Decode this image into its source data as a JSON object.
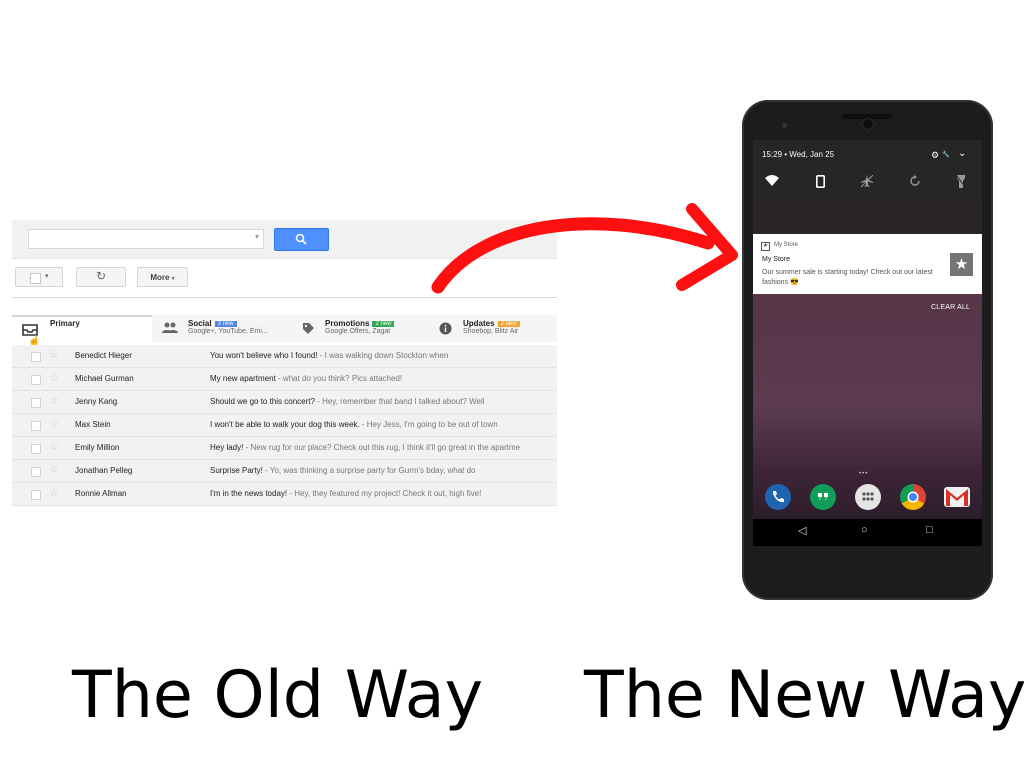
{
  "old_way": {
    "caption": "The Old Way",
    "toolbar": {
      "more_label": "More",
      "more_caret": "▾",
      "select_caret": "▾",
      "refresh_glyph": "↻",
      "search_caret": "▾"
    },
    "tabs": [
      {
        "name": "Primary",
        "sub": "",
        "badge": "",
        "icon": "inbox-icon"
      },
      {
        "name": "Social",
        "sub": "Google+, YouTube, Emi...",
        "badge": "3 new",
        "badge_color": "#4f85e8",
        "icon": "people-icon"
      },
      {
        "name": "Promotions",
        "sub": "Google Offers, Zagat",
        "badge": "2 new",
        "badge_color": "#35a853",
        "icon": "tag-icon"
      },
      {
        "name": "Updates",
        "sub": "Shoebop, Blitz Air",
        "badge": "2 new",
        "badge_color": "#f3a433",
        "icon": "info-icon"
      }
    ],
    "emails": [
      {
        "sender": "Benedict Hieger",
        "subject": "You won't believe who I found!",
        "snippet": " - I was walking down Stockton when"
      },
      {
        "sender": "Michael Gurman",
        "subject": "My new apartment",
        "snippet": " - what do you think? Pics attached!"
      },
      {
        "sender": "Jenny Kang",
        "subject": "Should we go to this concert?",
        "snippet": " - Hey, remember that band I talked about? Well"
      },
      {
        "sender": "Max Stein",
        "subject": "I won't be able to walk your dog this week.",
        "snippet": " - Hey Jess, I'm going to be out of town"
      },
      {
        "sender": "Emily Million",
        "subject": "Hey lady!",
        "snippet": " - New rug for our place? Check out this rug, I think it'll go great in the apartme"
      },
      {
        "sender": "Jonathan Pelleg",
        "subject": "Surprise Party!",
        "snippet": " - Yo, was thinking a surprise party for Gurm's bday, what do"
      },
      {
        "sender": "Ronnie Allman",
        "subject": "I'm in the news today!",
        "snippet": " - Hey, they featured my project! Check it out, high five!"
      }
    ]
  },
  "new_way": {
    "caption": "The New Way",
    "status": {
      "time_date": "15:29 • Wed, Jan 25",
      "gear_glyph": "⚙",
      "wrench_glyph": "🔧",
      "chevron_glyph": "⌄"
    },
    "quick_settings": [
      "wifi-icon",
      "phone-icon",
      "airplane-icon",
      "rotate-icon",
      "flashlight-icon"
    ],
    "notification": {
      "app_icon_glyph": "★",
      "app_name": "My Store",
      "title": "My Store",
      "body": "Our summer sale is starting today! Check out our latest fashions 😎",
      "image_glyph": "★"
    },
    "clear_all": "CLEAR ALL",
    "pager_dots": "•••",
    "dock": [
      {
        "name": "phone-app-icon",
        "color": "#1e64b0"
      },
      {
        "name": "hangouts-app-icon",
        "color": "#0f9d58"
      },
      {
        "name": "app-drawer-icon",
        "color": "#e5e5e5"
      },
      {
        "name": "chrome-app-icon",
        "color": "#db4437"
      },
      {
        "name": "gmail-app-icon",
        "color": "#d93025"
      }
    ],
    "nav": {
      "back": "◁",
      "home": "○",
      "recents": "□"
    }
  },
  "colors": {
    "accent_blue": "#4d90fe",
    "arrow_red": "#ff1010",
    "phone_body": "#1c1c1c"
  }
}
